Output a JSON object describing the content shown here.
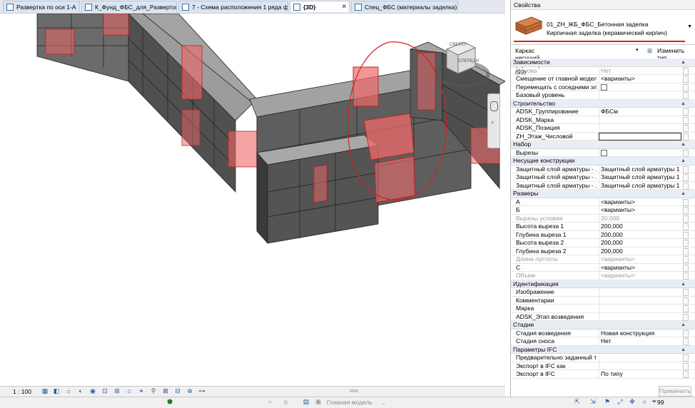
{
  "tabs": [
    {
      "label": "Развертка по оси 1-А"
    },
    {
      "label": "К_Фунд_ФБС_для_Разверток"
    },
    {
      "label": "7 - Схема расположения 1 ряда ф..."
    },
    {
      "label": "{3D}"
    },
    {
      "label": "Спец_ФБС (материалы заделка)"
    }
  ],
  "viewcube": {
    "top": "СВЕРХУ",
    "front": "СПЕРЕДИ"
  },
  "viewbar": {
    "scale": "1 : 100"
  },
  "statusbar": {
    "worksets": "0",
    "model": "Главная модель",
    "filter": "99"
  },
  "properties": {
    "title": "Свойства",
    "type_line1": "01_ZH_ЖБ_ФБС_Бетонная заделка",
    "type_line2": "Кирпичная заделка (керамический кирпич)",
    "category": "Каркас несущий (Прочее) (99)",
    "edit_type": "Изменить тип",
    "apply": "Применить",
    "groups": [
      {
        "name": "Зависимости",
        "rows": [
          {
            "label": "Основа",
            "value": "Нет",
            "grey": true
          },
          {
            "label": "Смещение от главной модели",
            "value": "<варианты>"
          },
          {
            "label": "Перемещать с соседними эл...",
            "value": "",
            "checkbox": true
          },
          {
            "label": "Базовый уровень",
            "value": ""
          }
        ]
      },
      {
        "name": "Строительство",
        "rows": [
          {
            "label": "ADSK_Группирование",
            "value": "ФБСм"
          },
          {
            "label": "ADSK_Марка",
            "value": ""
          },
          {
            "label": "ADSK_Позиция",
            "value": ""
          },
          {
            "label": "ZH_Этаж_Числовой",
            "value": "",
            "editing": true
          }
        ]
      },
      {
        "name": "Набор",
        "rows": [
          {
            "label": "Вырезы",
            "value": "",
            "checkbox": true
          }
        ]
      },
      {
        "name": "Несущие конструкции",
        "rows": [
          {
            "label": "Защитный слой арматуры - ...",
            "value": "Защитный слой арматуры 1 <..."
          },
          {
            "label": "Защитный слой арматуры - ...",
            "value": "Защитный слой арматуры 1 <..."
          },
          {
            "label": "Защитный слой арматуры - ...",
            "value": "Защитный слой арматуры 1 <..."
          }
        ]
      },
      {
        "name": "Размеры",
        "rows": [
          {
            "label": "А",
            "value": "<варианты>"
          },
          {
            "label": "Б",
            "value": "<варианты>"
          },
          {
            "label": "Вырезы условия",
            "value": "20,000",
            "grey": true
          },
          {
            "label": "Высота выреза 1",
            "value": "200,000"
          },
          {
            "label": "Глубина выреза 1",
            "value": "200,000"
          },
          {
            "label": "Высота выреза 2",
            "value": "200,000"
          },
          {
            "label": "Глубина выреза 2",
            "value": "200,000"
          },
          {
            "label": "Длина пустоты",
            "value": "<варианты>",
            "grey": true
          },
          {
            "label": "С",
            "value": "<варианты>"
          },
          {
            "label": "Объем",
            "value": "<варианты>",
            "grey": true
          }
        ]
      },
      {
        "name": "Идентификация",
        "rows": [
          {
            "label": "Изображение",
            "value": ""
          },
          {
            "label": "Комментарии",
            "value": ""
          },
          {
            "label": "Марка",
            "value": ""
          },
          {
            "label": "ADSK_Этап возведения",
            "value": ""
          }
        ]
      },
      {
        "name": "Стадии",
        "rows": [
          {
            "label": "Стадия возведения",
            "value": "Новая конструкция"
          },
          {
            "label": "Стадия сноса",
            "value": "Нет"
          }
        ]
      },
      {
        "name": "Параметры IFC",
        "rows": [
          {
            "label": "Предварительно заданный ти...",
            "value": ""
          },
          {
            "label": "Экспорт в IFC как",
            "value": ""
          },
          {
            "label": "Экспорт в IFC",
            "value": "По типу"
          }
        ]
      }
    ]
  },
  "colors": {
    "highlight": "#e34a4a",
    "annotation": "#d81e1e",
    "block_top": "#9c9c9c",
    "block_side": "#5a5a5a"
  }
}
